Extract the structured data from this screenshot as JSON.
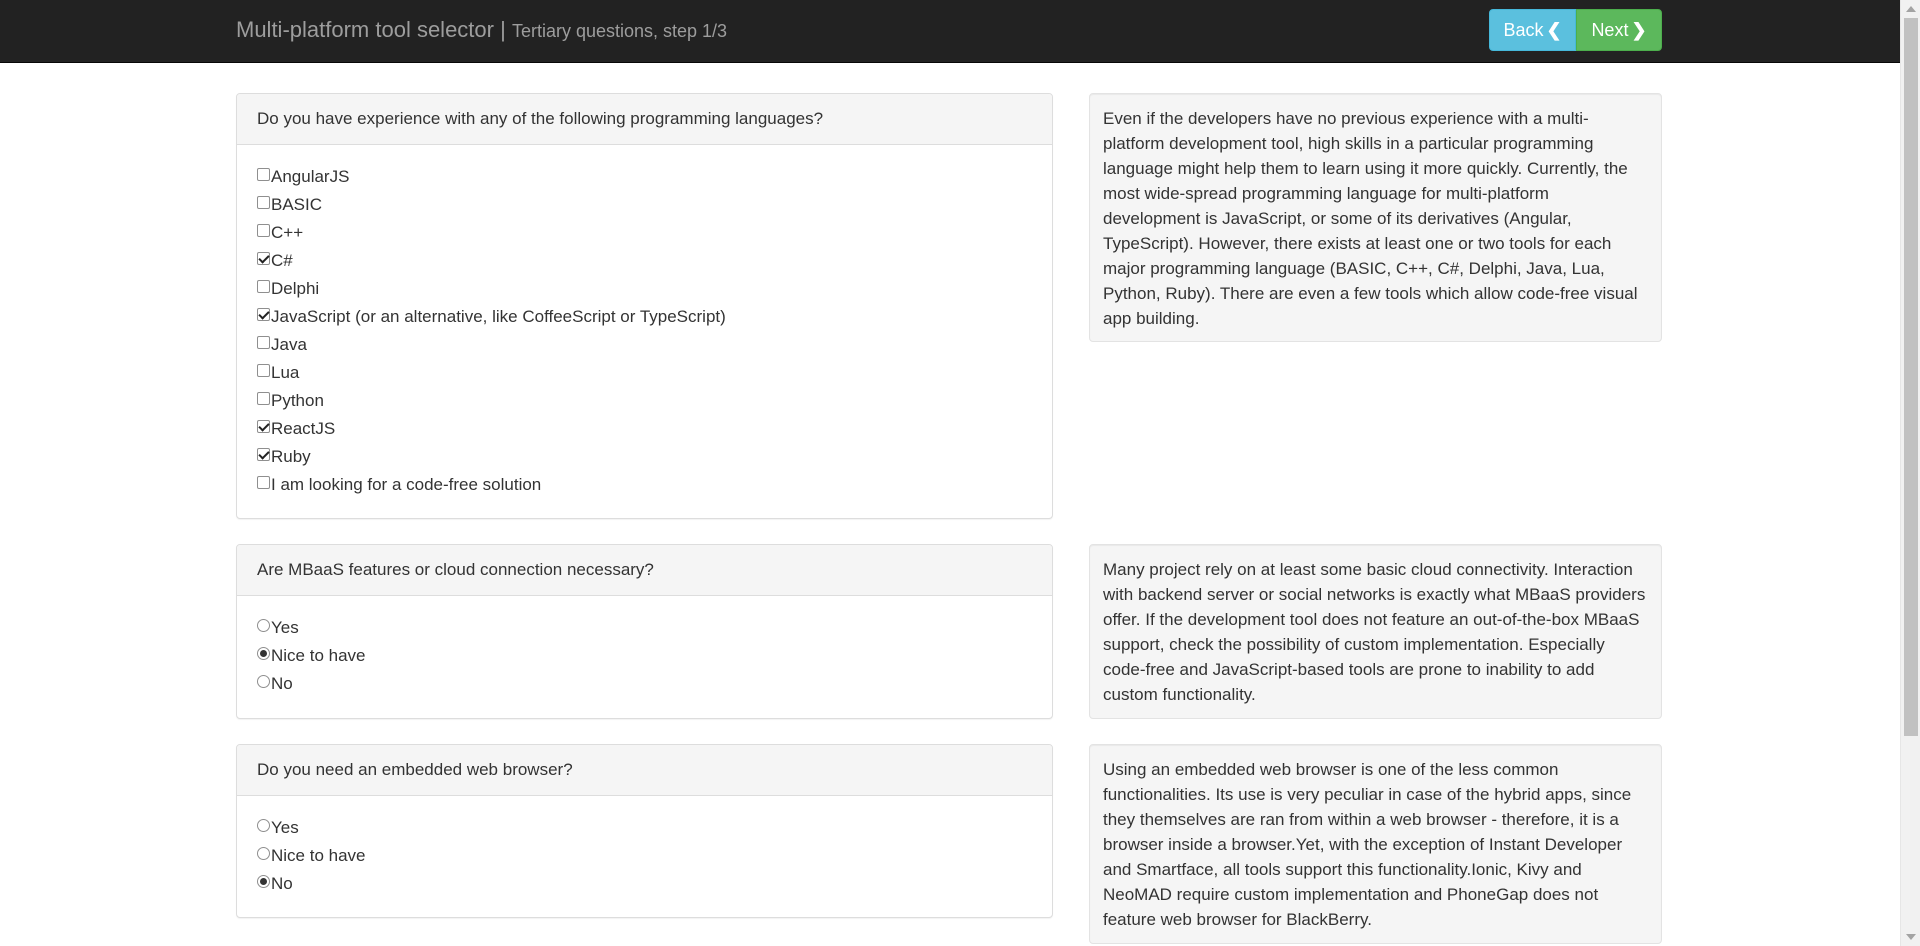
{
  "header": {
    "title": "Multi-platform tool selector",
    "separator": " | ",
    "subtitle": "Tertiary questions, step 1/3",
    "back_label": "Back",
    "next_label": "Next",
    "back_icon": "chevron-left-icon",
    "next_icon": "chevron-right-icon"
  },
  "questions": [
    {
      "title": "Do you have experience with any of the following programming languages?",
      "type": "checkbox",
      "options": [
        {
          "label": "AngularJS",
          "checked": false
        },
        {
          "label": "BASIC",
          "checked": false
        },
        {
          "label": "C++",
          "checked": false
        },
        {
          "label": "C#",
          "checked": true
        },
        {
          "label": "Delphi",
          "checked": false
        },
        {
          "label": "JavaScript (or an alternative, like CoffeeScript or TypeScript)",
          "checked": true
        },
        {
          "label": "Java",
          "checked": false
        },
        {
          "label": "Lua",
          "checked": false
        },
        {
          "label": "Python",
          "checked": false
        },
        {
          "label": "ReactJS",
          "checked": true
        },
        {
          "label": "Ruby",
          "checked": true
        },
        {
          "label": "I am looking for a code-free solution",
          "checked": false
        }
      ],
      "info": "Even if the developers have no previous experience with a multi-platform development tool, high skills in a particular programming language might help them to learn using it more quickly. Currently, the most wide-spread programming language for multi-platform development is JavaScript, or some of its derivatives (Angular, TypeScript). However, there exists at least one or two tools for each major programming language (BASIC, C++, C#, Delphi, Java, Lua, Python, Ruby). There are even a few tools which allow code-free visual app building."
    },
    {
      "title": "Are MBaaS features or cloud connection necessary?",
      "type": "radio",
      "options": [
        {
          "label": "Yes",
          "checked": false
        },
        {
          "label": "Nice to have",
          "checked": true
        },
        {
          "label": "No",
          "checked": false
        }
      ],
      "info": "Many project rely on at least some basic cloud connectivity. Interaction with backend server or social networks is exactly what MBaaS providers offer. If the development tool does not feature an out-of-the-box MBaaS support, check the possibility of custom implementation. Especially code-free and JavaScript-based tools are prone to inability to add custom functionality."
    },
    {
      "title": "Do you need an embedded web browser?",
      "type": "radio",
      "options": [
        {
          "label": "Yes",
          "checked": false
        },
        {
          "label": "Nice to have",
          "checked": false
        },
        {
          "label": "No",
          "checked": true
        }
      ],
      "info": "Using an embedded web browser is one of the less common functionalities. Its use is very peculiar in case of the hybrid apps, since they themselves are ran from within a web browser - therefore, it is a browser inside a browser.Yet, with the exception of Instant Developer and Smartface, all tools support this functionality.Ionic, Kivy and NeoMAD require custom implementation and PhoneGap does not feature web browser for BlackBerry."
    }
  ]
}
